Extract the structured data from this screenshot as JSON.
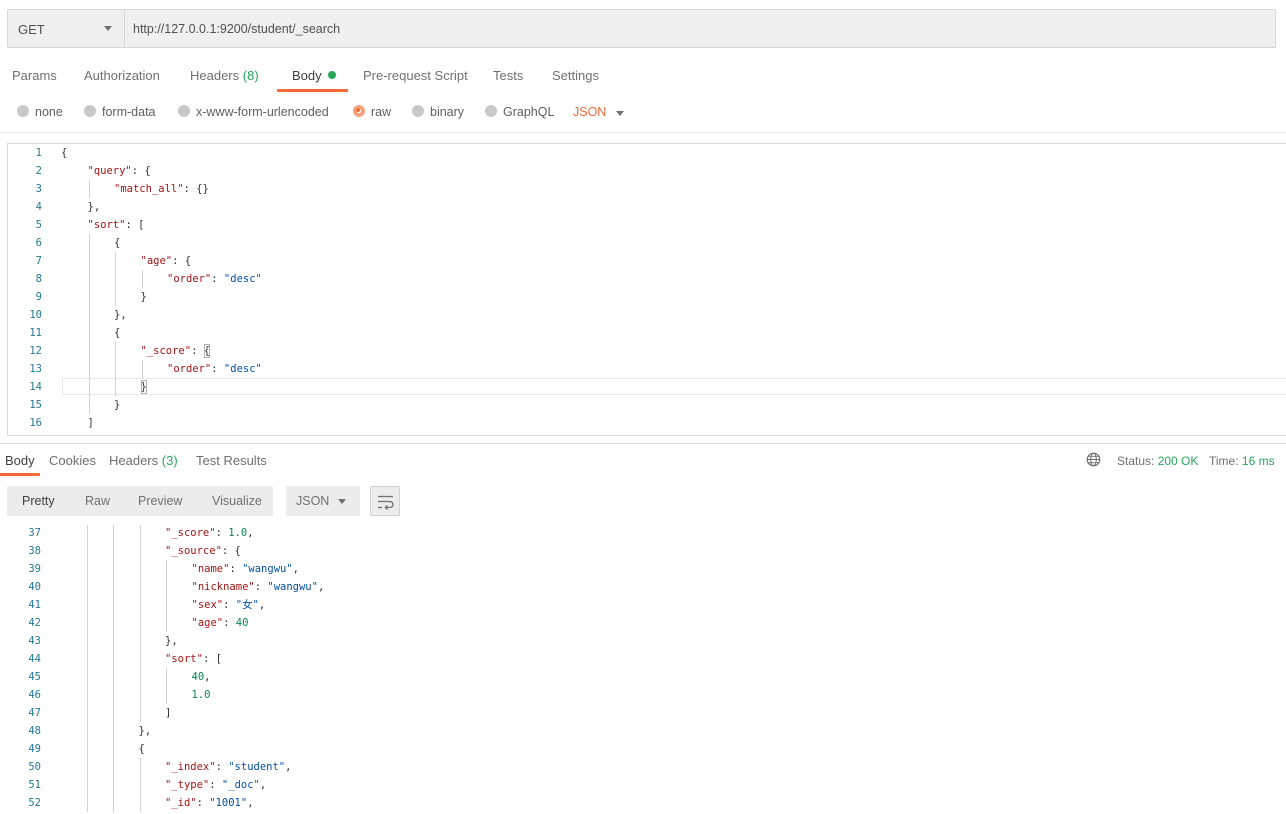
{
  "request": {
    "method": "GET",
    "url": "http://127.0.0.1:9200/student/_search"
  },
  "request_tabs": [
    {
      "label": "Params"
    },
    {
      "label": "Authorization"
    },
    {
      "label": "Headers",
      "count": "(8)"
    },
    {
      "label": "Body",
      "active": true
    },
    {
      "label": "Pre-request Script"
    },
    {
      "label": "Tests"
    },
    {
      "label": "Settings"
    }
  ],
  "body_types": [
    {
      "label": "none"
    },
    {
      "label": "form-data"
    },
    {
      "label": "x-www-form-urlencoded"
    },
    {
      "label": "raw",
      "checked": true
    },
    {
      "label": "binary"
    },
    {
      "label": "GraphQL"
    }
  ],
  "raw_format": "JSON",
  "request_body_lines": [
    {
      "n": "1",
      "i": 0,
      "t": [
        [
          "p",
          "{"
        ]
      ]
    },
    {
      "n": "2",
      "i": 1,
      "t": [
        [
          "k",
          "\"query\""
        ],
        [
          "p",
          ": {"
        ]
      ]
    },
    {
      "n": "3",
      "i": 2,
      "t": [
        [
          "k",
          "\"match_all\""
        ],
        [
          "p",
          ": {}"
        ]
      ]
    },
    {
      "n": "4",
      "i": 1,
      "t": [
        [
          "p",
          "},"
        ]
      ]
    },
    {
      "n": "5",
      "i": 1,
      "t": [
        [
          "k",
          "\"sort\""
        ],
        [
          "p",
          ": ["
        ]
      ]
    },
    {
      "n": "6",
      "i": 2,
      "t": [
        [
          "p",
          "{"
        ]
      ]
    },
    {
      "n": "7",
      "i": 3,
      "t": [
        [
          "k",
          "\"age\""
        ],
        [
          "p",
          ": {"
        ]
      ]
    },
    {
      "n": "8",
      "i": 4,
      "t": [
        [
          "k",
          "\"order\""
        ],
        [
          "p",
          ": "
        ],
        [
          "s",
          "\"desc\""
        ]
      ]
    },
    {
      "n": "9",
      "i": 3,
      "t": [
        [
          "p",
          "}"
        ]
      ]
    },
    {
      "n": "10",
      "i": 2,
      "t": [
        [
          "p",
          "},"
        ]
      ]
    },
    {
      "n": "11",
      "i": 2,
      "t": [
        [
          "p",
          "{"
        ]
      ]
    },
    {
      "n": "12",
      "i": 3,
      "t": [
        [
          "k",
          "\"_score\""
        ],
        [
          "p",
          ": {"
        ]
      ]
    },
    {
      "n": "13",
      "i": 4,
      "t": [
        [
          "k",
          "\"order\""
        ],
        [
          "p",
          ": "
        ],
        [
          "s",
          "\"desc\""
        ]
      ]
    },
    {
      "n": "14",
      "i": 3,
      "t": [
        [
          "p",
          "}"
        ]
      ]
    },
    {
      "n": "15",
      "i": 2,
      "t": [
        [
          "p",
          "}"
        ]
      ]
    },
    {
      "n": "16",
      "i": 1,
      "t": [
        [
          "p",
          "]"
        ]
      ]
    }
  ],
  "response_tabs": [
    {
      "label": "Body",
      "active": true
    },
    {
      "label": "Cookies"
    },
    {
      "label": "Headers",
      "count": "(3)"
    },
    {
      "label": "Test Results"
    }
  ],
  "response_status": {
    "status_label": "Status:",
    "status_value": "200 OK",
    "time_label": "Time:",
    "time_value": "16 ms"
  },
  "response_views": [
    "Pretty",
    "Raw",
    "Preview",
    "Visualize"
  ],
  "response_format": "JSON",
  "response_body_lines": [
    {
      "n": "37",
      "i": 4,
      "t": [
        [
          "k",
          "\"_score\""
        ],
        [
          "p",
          ": "
        ],
        [
          "n",
          "1.0"
        ],
        [
          "p",
          ","
        ]
      ]
    },
    {
      "n": "38",
      "i": 4,
      "t": [
        [
          "k",
          "\"_source\""
        ],
        [
          "p",
          ": {"
        ]
      ]
    },
    {
      "n": "39",
      "i": 5,
      "t": [
        [
          "k",
          "\"name\""
        ],
        [
          "p",
          ": "
        ],
        [
          "s",
          "\"wangwu\""
        ],
        [
          "p",
          ","
        ]
      ]
    },
    {
      "n": "40",
      "i": 5,
      "t": [
        [
          "k",
          "\"nickname\""
        ],
        [
          "p",
          ": "
        ],
        [
          "s",
          "\"wangwu\""
        ],
        [
          "p",
          ","
        ]
      ]
    },
    {
      "n": "41",
      "i": 5,
      "t": [
        [
          "k",
          "\"sex\""
        ],
        [
          "p",
          ": "
        ],
        [
          "s",
          "\"女\""
        ],
        [
          "p",
          ","
        ]
      ]
    },
    {
      "n": "42",
      "i": 5,
      "t": [
        [
          "k",
          "\"age\""
        ],
        [
          "p",
          ": "
        ],
        [
          "n",
          "40"
        ]
      ]
    },
    {
      "n": "43",
      "i": 4,
      "t": [
        [
          "p",
          "},"
        ]
      ]
    },
    {
      "n": "44",
      "i": 4,
      "t": [
        [
          "k",
          "\"sort\""
        ],
        [
          "p",
          ": ["
        ]
      ]
    },
    {
      "n": "45",
      "i": 5,
      "t": [
        [
          "n",
          "40"
        ],
        [
          "p",
          ","
        ]
      ]
    },
    {
      "n": "46",
      "i": 5,
      "t": [
        [
          "n",
          "1.0"
        ]
      ]
    },
    {
      "n": "47",
      "i": 4,
      "t": [
        [
          "p",
          "]"
        ]
      ]
    },
    {
      "n": "48",
      "i": 3,
      "t": [
        [
          "p",
          "},"
        ]
      ]
    },
    {
      "n": "49",
      "i": 3,
      "t": [
        [
          "p",
          "{"
        ]
      ]
    },
    {
      "n": "50",
      "i": 4,
      "t": [
        [
          "k",
          "\"_index\""
        ],
        [
          "p",
          ": "
        ],
        [
          "s",
          "\"student\""
        ],
        [
          "p",
          ","
        ]
      ]
    },
    {
      "n": "51",
      "i": 4,
      "t": [
        [
          "k",
          "\"_type\""
        ],
        [
          "p",
          ": "
        ],
        [
          "s",
          "\"_doc\""
        ],
        [
          "p",
          ","
        ]
      ]
    },
    {
      "n": "52",
      "i": 4,
      "t": [
        [
          "k",
          "\"_id\""
        ],
        [
          "p",
          ": "
        ],
        [
          "s",
          "\"1001\""
        ],
        [
          "p",
          ","
        ]
      ]
    }
  ],
  "colors": {
    "accent": "#f26b3a",
    "success": "#26a65b",
    "json_key": "#a31515",
    "json_string": "#0451a5",
    "json_number": "#098658",
    "line_number": "#237893"
  },
  "icons": {
    "method_dropdown": "chevron-down-icon",
    "format_dropdown": "chevron-down-icon",
    "network": "globe-icon",
    "wrap": "wrap-lines-icon"
  }
}
